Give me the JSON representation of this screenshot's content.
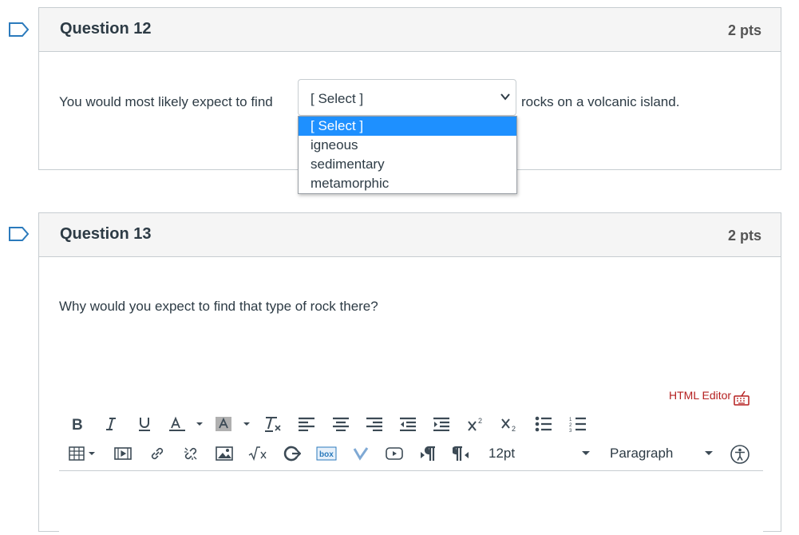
{
  "question12": {
    "title": "Question 12",
    "points": "2 pts",
    "text_before": "You would most likely expect to find",
    "text_after": "rocks on a volcanic island.",
    "select": {
      "value": "[ Select ]",
      "options": [
        "[ Select ]",
        "igneous",
        "sedimentary",
        "metamorphic"
      ],
      "highlighted_index": 0
    }
  },
  "question13": {
    "title": "Question 13",
    "points": "2 pts",
    "text": "Why would you expect to find that type of rock there?",
    "html_editor_link": "HTML Editor",
    "toolbar": {
      "font_size": "12pt",
      "block_format": "Paragraph"
    }
  },
  "colors": {
    "accent_blue": "#1e90ff",
    "html_editor_red": "#b51f1f",
    "flag_blue": "#2b7abc"
  },
  "icons": [
    "bold-icon",
    "italic-icon",
    "underline-icon",
    "text-color-icon",
    "background-color-icon",
    "clear-formatting-icon",
    "align-left-icon",
    "align-center-icon",
    "align-right-icon",
    "outdent-icon",
    "indent-icon",
    "superscript-icon",
    "subscript-icon",
    "bullet-list-icon",
    "numbered-list-icon",
    "table-icon",
    "media-icon",
    "link-icon",
    "unlink-icon",
    "image-icon",
    "math-icon",
    "embed-icon",
    "box-icon",
    "vimeo-icon",
    "video-icon",
    "ltr-icon",
    "rtl-icon",
    "accessibility-icon"
  ]
}
